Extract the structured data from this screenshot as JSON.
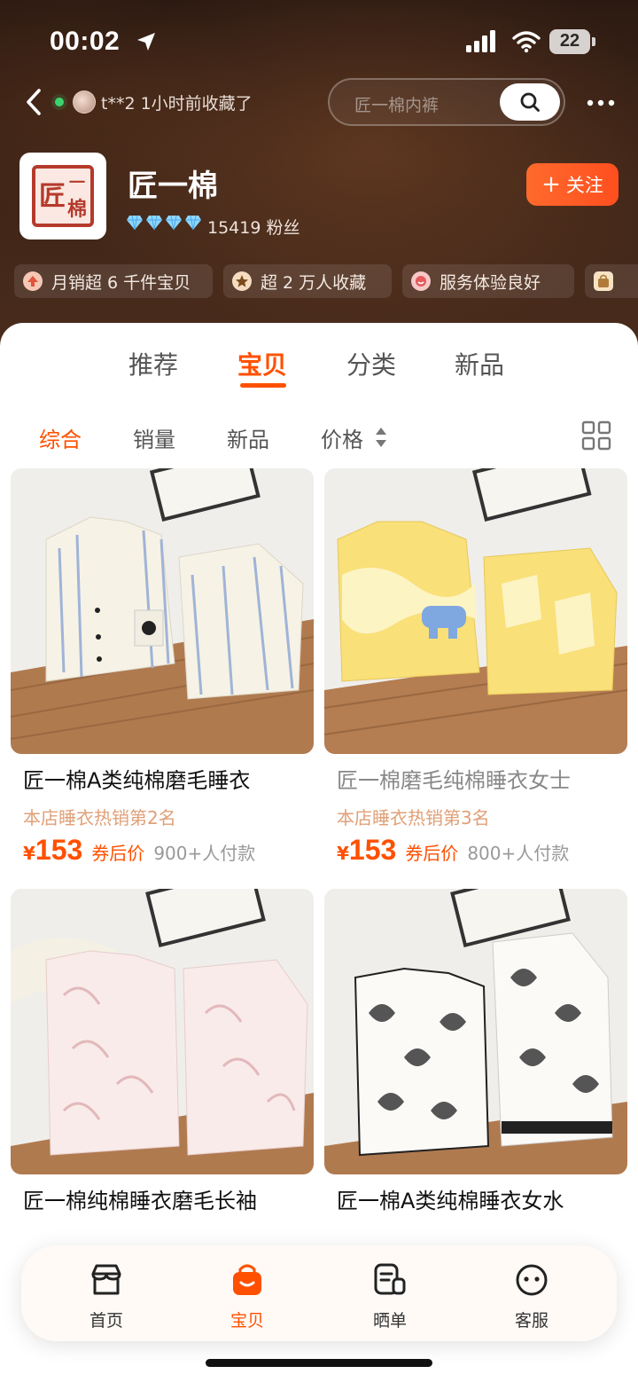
{
  "status_bar": {
    "time": "00:02",
    "battery": "22"
  },
  "nav": {
    "visitor_text": "t**2 1小时前收藏了",
    "search_placeholder": "匠一棉内裤"
  },
  "shop": {
    "logo_text_1": "匠",
    "logo_text_2": "一",
    "logo_text_3": "棉",
    "name": "匠一棉",
    "fans": "15419 粉丝",
    "follow_label": "关注",
    "follow_plus": "+"
  },
  "tags": [
    {
      "label": "月销超 6 千件宝贝"
    },
    {
      "label": "超 2 万人收藏"
    },
    {
      "label": "服务体验良好"
    }
  ],
  "main_tabs": [
    {
      "label": "推荐"
    },
    {
      "label": "宝贝"
    },
    {
      "label": "分类"
    },
    {
      "label": "新品"
    }
  ],
  "sort": [
    {
      "label": "综合"
    },
    {
      "label": "销量"
    },
    {
      "label": "新品"
    },
    {
      "label": "价格"
    }
  ],
  "products": [
    {
      "title": "匠一棉A类纯棉磨毛睡衣",
      "rank": "本店睡衣热销第2名",
      "yen": "¥",
      "price": "153",
      "price_label": "券后价",
      "paid": "900+人付款"
    },
    {
      "title": "匠一棉磨毛纯棉睡衣女士",
      "rank": "本店睡衣热销第3名",
      "yen": "¥",
      "price": "153",
      "price_label": "券后价",
      "paid": "800+人付款"
    },
    {
      "title": "匠一棉纯棉睡衣磨毛长袖"
    },
    {
      "title": "匠一棉A类纯棉睡衣女水"
    }
  ],
  "bottom_nav": [
    {
      "label": "首页"
    },
    {
      "label": "宝贝"
    },
    {
      "label": "晒单"
    },
    {
      "label": "客服"
    }
  ],
  "colors": {
    "accent": "#ff5000",
    "header_bg": "#3d2417"
  }
}
